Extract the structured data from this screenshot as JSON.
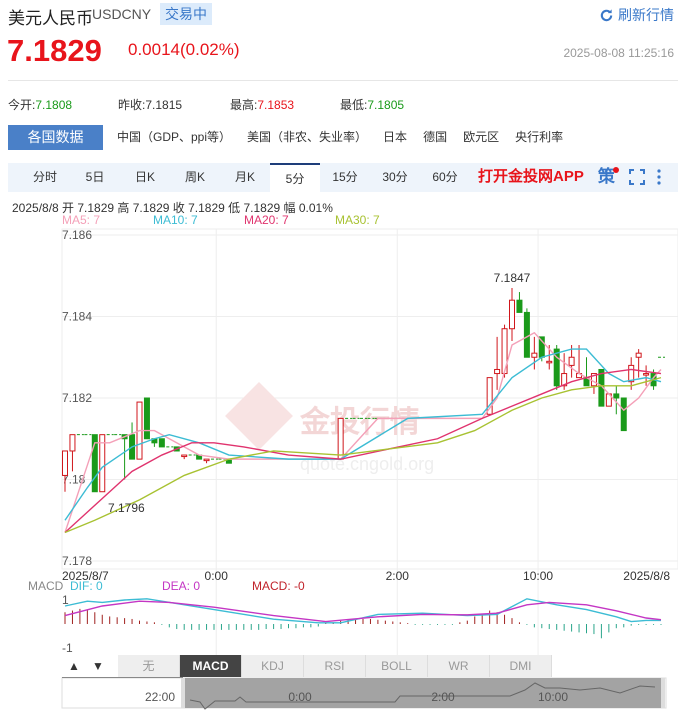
{
  "header": {
    "title": "美元人民币",
    "code": "USDCNY",
    "status": "交易中",
    "refresh_label": "刷新行情"
  },
  "quote": {
    "price": "7.1829",
    "change": "0.0014(0.02%)",
    "timestamp": "2025-08-08 11:25:16"
  },
  "stats": [
    {
      "label": "今开:",
      "value": "7.1808",
      "color": "green"
    },
    {
      "label": "昨收:",
      "value": "7.1815",
      "color": ""
    },
    {
      "label": "最高:",
      "value": "7.1853",
      "color": "red"
    },
    {
      "label": "最低:",
      "value": "7.1805",
      "color": "green"
    }
  ],
  "data_tabs": [
    "各国数据",
    "中国（GDP、ppi等）",
    "美国（非农、失业率）",
    "日本",
    "德国",
    "欧元区",
    "央行利率"
  ],
  "period_tabs": [
    "分时",
    "5日",
    "日K",
    "周K",
    "月K",
    "5分",
    "15分",
    "30分",
    "60分"
  ],
  "active_period": "5分",
  "app_link": "打开金投网APP",
  "strategy_label": "策",
  "info_line": "2025/8/8  开 7.1829  高 7.1829  收 7.1829  低 7.1829  幅 0.01%",
  "ma_labels": {
    "ma5": "MA5: 7",
    "ma10": "MA10: 7",
    "ma20": "MA20: 7",
    "ma30": "MA30: 7"
  },
  "colors": {
    "up": "#d0161b",
    "down": "#1a9a1a",
    "ma5": "#f4a0b8",
    "ma10": "#3cbcd4",
    "ma20": "#e0336e",
    "ma30": "#a8c232",
    "dif": "#3cbcd4",
    "dea": "#c436c4"
  },
  "watermark": "金投行情 quote.cngold.org",
  "chart_data": {
    "type": "candlestick",
    "ylim": [
      7.178,
      7.186
    ],
    "yticks": [
      "7.186",
      "7.184",
      "7.182",
      "7.18",
      "7.178"
    ],
    "xticks": [
      {
        "slot": 0,
        "label": "2025/8/7"
      },
      {
        "slot": 20.3,
        "label": "0:00"
      },
      {
        "slot": 44.6,
        "label": "2:00"
      },
      {
        "slot": 63.5,
        "label": "10:00"
      },
      {
        "slot": 80,
        "label": "2025/8/8"
      }
    ],
    "max_label": {
      "slot": 60,
      "value": "7.1847"
    },
    "min_label": {
      "slot": 5,
      "value": "7.1796"
    },
    "candles": [
      [
        0,
        7.1801,
        7.1807,
        7.1807,
        7.1797
      ],
      [
        1,
        7.1807,
        7.1811,
        7.1811,
        7.1802
      ],
      [
        2,
        7.1811,
        7.1811,
        7.1811,
        7.1811
      ],
      [
        3,
        7.1811,
        7.1811,
        7.1811,
        7.1811
      ],
      [
        4,
        7.1811,
        7.1797,
        7.1811,
        7.1797
      ],
      [
        5,
        7.1797,
        7.1811,
        7.1811,
        7.1797
      ],
      [
        6,
        7.1811,
        7.1811,
        7.1811,
        7.1811
      ],
      [
        7,
        7.1811,
        7.1811,
        7.1811,
        7.1811
      ],
      [
        8,
        7.1811,
        7.181,
        7.1811,
        7.18
      ],
      [
        9,
        7.1811,
        7.1805,
        7.1814,
        7.1805
      ],
      [
        10,
        7.1805,
        7.1819,
        7.1819,
        7.1805
      ],
      [
        11,
        7.182,
        7.181,
        7.182,
        7.181
      ],
      [
        12,
        7.181,
        7.1809,
        7.181,
        7.1808
      ],
      [
        13,
        7.181,
        7.1808,
        7.181,
        7.1808
      ],
      [
        14,
        7.1808,
        7.1808,
        7.1808,
        7.1808
      ],
      [
        15,
        7.1808,
        7.1807,
        7.1808,
        7.1807
      ],
      [
        16,
        7.1806,
        7.1806,
        7.1806,
        7.1805
      ],
      [
        17,
        7.1806,
        7.1806,
        7.1806,
        7.1806
      ],
      [
        18,
        7.1806,
        7.1805,
        7.1806,
        7.1805
      ],
      [
        19,
        7.1805,
        7.1805,
        7.1805,
        7.1804
      ],
      [
        20,
        7.1805,
        7.1805,
        7.1805,
        7.1805
      ],
      [
        21,
        7.1805,
        7.1805,
        7.1805,
        7.1805
      ],
      [
        22,
        7.1805,
        7.1804,
        7.1805,
        7.1804
      ],
      [
        37,
        7.1805,
        7.1815,
        7.1815,
        7.1805
      ],
      [
        38,
        7.1815,
        7.1815,
        7.1815,
        7.1815
      ],
      [
        39,
        7.1815,
        7.1815,
        7.1815,
        7.1815
      ],
      [
        40,
        7.1815,
        7.1815,
        7.1815,
        7.1815
      ],
      [
        41,
        7.1815,
        7.1815,
        7.1815,
        7.1815
      ],
      [
        42,
        7.1815,
        7.1815,
        7.1815,
        7.1815
      ],
      [
        43,
        7.1815,
        7.1815,
        7.1815,
        7.1815
      ],
      [
        44,
        7.1815,
        7.1815,
        7.1815,
        7.1815
      ],
      [
        45,
        7.1815,
        7.1815,
        7.1815,
        7.1815
      ],
      [
        57,
        7.1816,
        7.1825,
        7.1825,
        7.1816
      ],
      [
        58,
        7.1826,
        7.1827,
        7.1835,
        7.1822
      ],
      [
        59,
        7.1826,
        7.1837,
        7.1838,
        7.1825
      ],
      [
        60,
        7.1837,
        7.1844,
        7.1847,
        7.1834
      ],
      [
        61,
        7.1844,
        7.1841,
        7.1846,
        7.1841
      ],
      [
        62,
        7.1841,
        7.183,
        7.1842,
        7.183
      ],
      [
        63,
        7.183,
        7.1831,
        7.1835,
        7.1827
      ],
      [
        64,
        7.1835,
        7.183,
        7.1835,
        7.1829
      ],
      [
        65,
        7.1829,
        7.1829,
        7.1833,
        7.1827
      ],
      [
        66,
        7.1832,
        7.1823,
        7.1833,
        7.1822
      ],
      [
        67,
        7.1823,
        7.1826,
        7.1831,
        7.1822
      ],
      [
        68,
        7.1828,
        7.183,
        7.1833,
        7.1825
      ],
      [
        69,
        7.1825,
        7.1826,
        7.1833,
        7.1825
      ],
      [
        70,
        7.1825,
        7.1823,
        7.183,
        7.1823
      ],
      [
        71,
        7.1823,
        7.1826,
        7.1826,
        7.1821
      ],
      [
        72,
        7.1827,
        7.1818,
        7.1827,
        7.1818
      ],
      [
        73,
        7.1818,
        7.1821,
        7.1821,
        7.1818
      ],
      [
        74,
        7.1821,
        7.182,
        7.1823,
        7.1816
      ],
      [
        75,
        7.182,
        7.1812,
        7.182,
        7.1812
      ],
      [
        76,
        7.1824,
        7.1828,
        7.183,
        7.1822
      ],
      [
        77,
        7.183,
        7.1831,
        7.1832,
        7.1825
      ],
      [
        78,
        7.1826,
        7.1826,
        7.1828,
        7.1823
      ],
      [
        79,
        7.1826,
        7.1823,
        7.1827,
        7.1822
      ],
      [
        80,
        7.183,
        7.183,
        7.183,
        7.183
      ]
    ],
    "ma5": [
      [
        0,
        7.1787
      ],
      [
        4,
        7.1809
      ],
      [
        6,
        7.1809
      ],
      [
        10,
        7.1812
      ],
      [
        12,
        7.1812
      ],
      [
        14,
        7.181
      ],
      [
        18,
        7.1806
      ],
      [
        22,
        7.1805
      ],
      [
        37,
        7.1805
      ],
      [
        38,
        7.1807
      ],
      [
        42,
        7.1815
      ],
      [
        56,
        7.1815
      ],
      [
        58,
        7.182
      ],
      [
        60,
        7.1833
      ],
      [
        63,
        7.1836
      ],
      [
        66,
        7.183
      ],
      [
        69,
        7.1826
      ],
      [
        72,
        7.1823
      ],
      [
        75,
        7.1817
      ],
      [
        77,
        7.182
      ],
      [
        79,
        7.1825
      ],
      [
        80,
        7.1827
      ]
    ],
    "ma10": [
      [
        0,
        7.179
      ],
      [
        3,
        7.1798
      ],
      [
        5,
        7.1803
      ],
      [
        9,
        7.1808
      ],
      [
        12,
        7.181
      ],
      [
        14,
        7.1811
      ],
      [
        18,
        7.1809
      ],
      [
        22,
        7.1806
      ],
      [
        30,
        7.1805
      ],
      [
        37,
        7.1805
      ],
      [
        46,
        7.1815
      ],
      [
        56,
        7.1816
      ],
      [
        60,
        7.1825
      ],
      [
        64,
        7.183
      ],
      [
        68,
        7.1832
      ],
      [
        70,
        7.1832
      ],
      [
        73,
        7.1826
      ],
      [
        75,
        7.1824
      ],
      [
        78,
        7.1825
      ],
      [
        80,
        7.1824
      ]
    ],
    "ma20": [
      [
        0,
        7.1787
      ],
      [
        3,
        7.1792
      ],
      [
        6,
        7.1797
      ],
      [
        9,
        7.1802
      ],
      [
        13,
        7.1806
      ],
      [
        17,
        7.1809
      ],
      [
        20,
        7.1809
      ],
      [
        24,
        7.1808
      ],
      [
        30,
        7.1806
      ],
      [
        37,
        7.1805
      ],
      [
        50,
        7.181
      ],
      [
        56,
        7.1815
      ],
      [
        60,
        7.1818
      ],
      [
        64,
        7.1821
      ],
      [
        68,
        7.1824
      ],
      [
        72,
        7.1826
      ],
      [
        76,
        7.1827
      ],
      [
        80,
        7.1826
      ]
    ],
    "ma30": [
      [
        0,
        7.1787
      ],
      [
        4,
        7.179
      ],
      [
        10,
        7.1795
      ],
      [
        16,
        7.1801
      ],
      [
        22,
        7.1805
      ],
      [
        28,
        7.1807
      ],
      [
        37,
        7.1806
      ],
      [
        50,
        7.1809
      ],
      [
        55,
        7.1812
      ],
      [
        60,
        7.1817
      ],
      [
        64,
        7.182
      ],
      [
        68,
        7.1822
      ],
      [
        72,
        7.1823
      ],
      [
        76,
        7.1823
      ],
      [
        80,
        7.1825
      ]
    ],
    "macd": {
      "labels": {
        "name": "MACD",
        "dif": "DIF: 0",
        "dea": "DEA: 0",
        "macd": "MACD: -0"
      },
      "yticks": [
        "1",
        "-1"
      ],
      "ylim": [
        -1,
        1
      ],
      "dif": [
        [
          0,
          0.75
        ],
        [
          3,
          0.95
        ],
        [
          5,
          0.9
        ],
        [
          8,
          1.0
        ],
        [
          11,
          1.05
        ],
        [
          15,
          0.85
        ],
        [
          20,
          0.6
        ],
        [
          28,
          0.2
        ],
        [
          34,
          0.05
        ],
        [
          37,
          0.05
        ],
        [
          42,
          0.4
        ],
        [
          48,
          0.45
        ],
        [
          54,
          0.35
        ],
        [
          58,
          0.4
        ],
        [
          62,
          1.05
        ],
        [
          66,
          0.8
        ],
        [
          70,
          0.6
        ],
        [
          74,
          0.3
        ],
        [
          76,
          0.1
        ],
        [
          78,
          0.15
        ],
        [
          80,
          0.15
        ]
      ],
      "dea": [
        [
          0,
          0.35
        ],
        [
          5,
          0.75
        ],
        [
          10,
          0.95
        ],
        [
          14,
          0.9
        ],
        [
          20,
          0.7
        ],
        [
          28,
          0.35
        ],
        [
          35,
          0.1
        ],
        [
          42,
          0.3
        ],
        [
          48,
          0.4
        ],
        [
          54,
          0.38
        ],
        [
          58,
          0.45
        ],
        [
          62,
          0.8
        ],
        [
          65,
          0.9
        ],
        [
          70,
          0.8
        ],
        [
          74,
          0.55
        ],
        [
          78,
          0.25
        ],
        [
          80,
          0.18
        ]
      ],
      "hist": [
        0.7,
        0.8,
        0.9,
        0.85,
        0.7,
        0.55,
        0.45,
        0.4,
        0.35,
        0.3,
        0.2,
        0.15,
        0.1,
        -0.05,
        -0.2,
        -0.3,
        -0.35,
        -0.35,
        -0.35,
        -0.35,
        -0.35,
        -0.35,
        -0.35,
        -0.35,
        -0.35,
        -0.35,
        -0.35,
        -0.3,
        -0.3,
        -0.3,
        -0.25,
        -0.25,
        -0.2,
        -0.2,
        -0.15,
        0.05,
        0.1,
        0.2,
        0.25,
        0.3,
        0.3,
        0.3,
        0.25,
        0.2,
        0.15,
        0.1,
        0.05,
        -0.05,
        -0.05,
        -0.05,
        -0.05,
        -0.05,
        -0.05,
        0.1,
        0.2,
        0.45,
        0.6,
        0.8,
        0.7,
        0.55,
        0.35,
        0.1,
        -0.05,
        -0.2,
        -0.25,
        -0.3,
        -0.35,
        -0.4,
        -0.45,
        -0.5,
        -0.55,
        -0.6,
        -0.85,
        -0.5,
        -0.25,
        -0.2,
        -0.1,
        -0.05,
        -0.05,
        -0.05,
        -0.05
      ]
    },
    "indicator_tabs": [
      "无",
      "MACD",
      "KDJ",
      "RSI",
      "BOLL",
      "WR",
      "DMI"
    ],
    "active_indicator": "MACD",
    "navigator_ticks": [
      "22:00",
      "0:00",
      "2:00",
      "10:00"
    ]
  }
}
